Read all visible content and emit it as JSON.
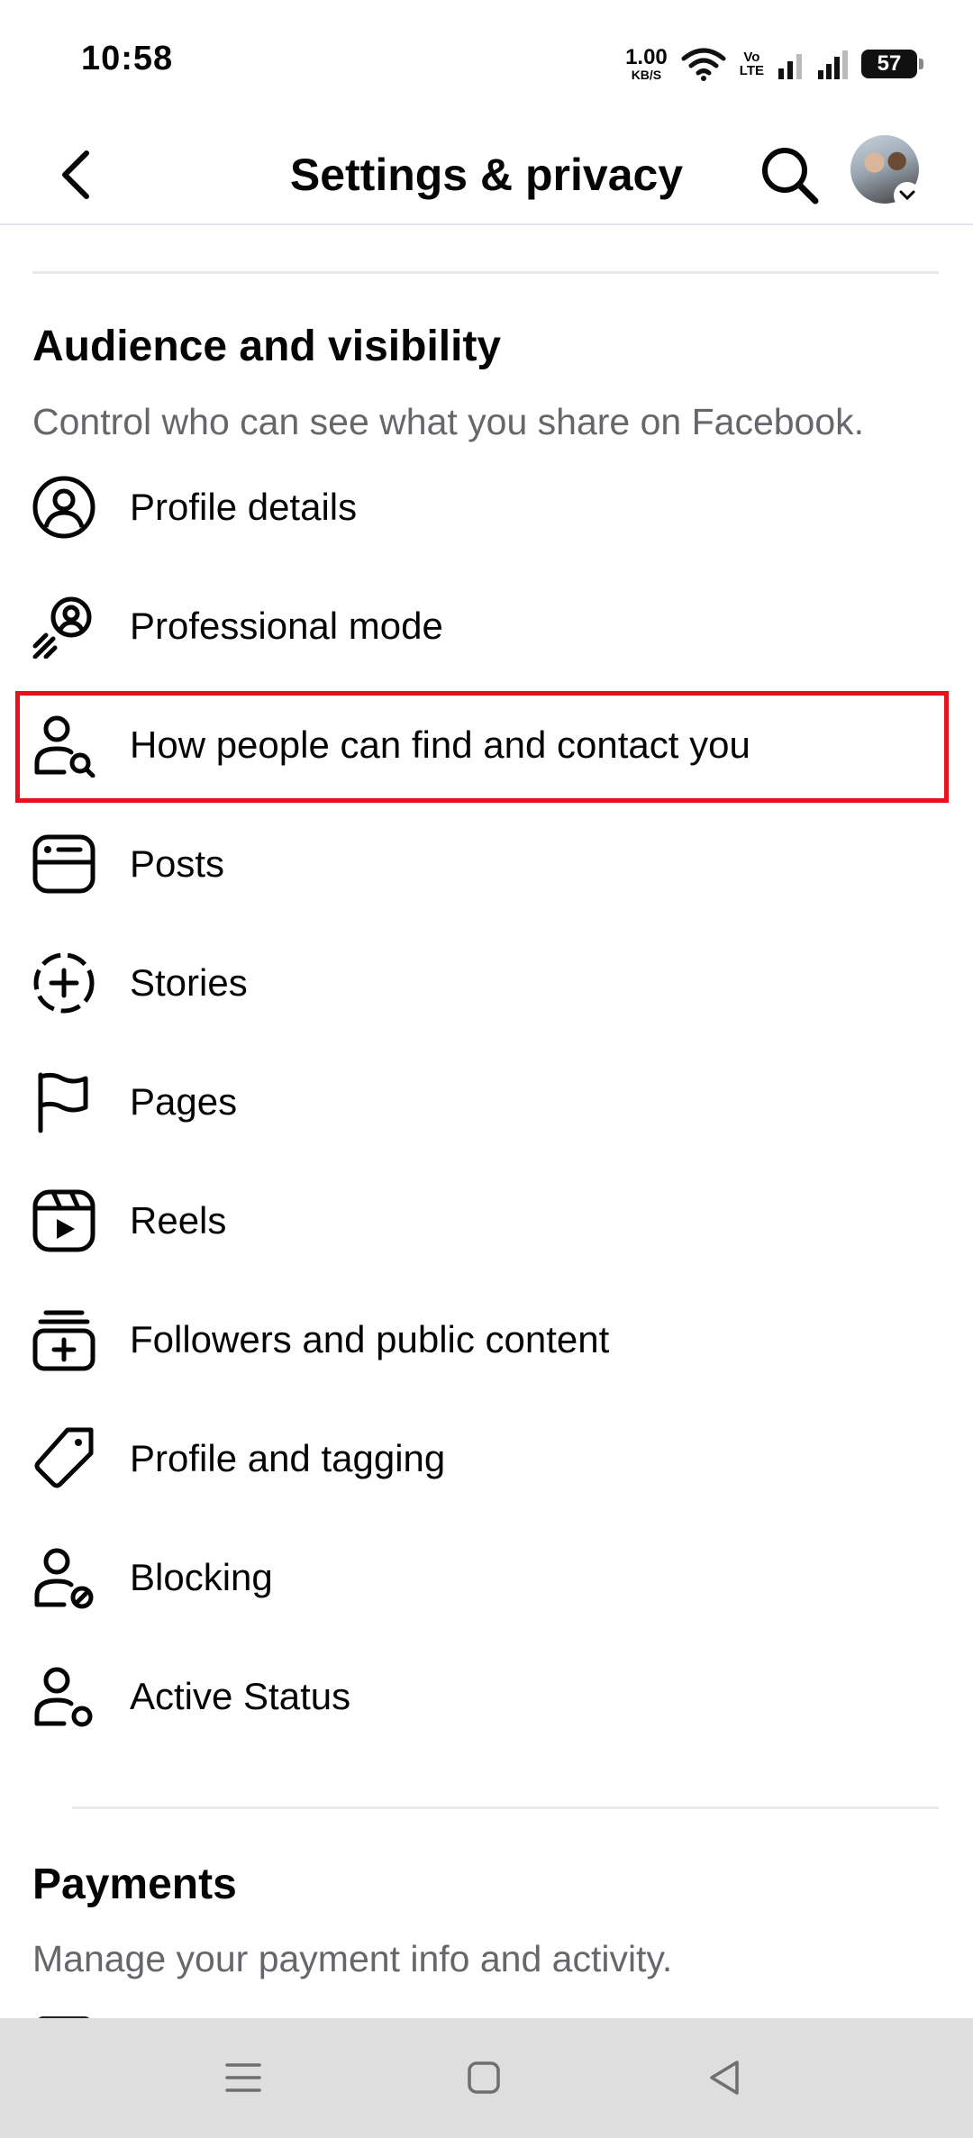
{
  "status_bar": {
    "time": "10:58",
    "net_speed_value": "1.00",
    "net_speed_unit": "KB/S",
    "volte_top": "Vo",
    "volte_bottom": "LTE",
    "battery": "57"
  },
  "header": {
    "title": "Settings & privacy",
    "back_icon": "chevron-left-icon",
    "search_icon": "search-icon"
  },
  "audience_section": {
    "title": "Audience and visibility",
    "description": "Control who can see what you share on Facebook.",
    "items": [
      {
        "label": "Profile details",
        "icon": "person-circle-icon"
      },
      {
        "label": "Professional mode",
        "icon": "professional-mode-icon"
      },
      {
        "label": "How people can find and contact you",
        "icon": "person-search-icon",
        "highlighted": true
      },
      {
        "label": "Posts",
        "icon": "posts-icon"
      },
      {
        "label": "Stories",
        "icon": "stories-plus-icon"
      },
      {
        "label": "Pages",
        "icon": "flag-icon"
      },
      {
        "label": "Reels",
        "icon": "reels-icon"
      },
      {
        "label": "Followers and public content",
        "icon": "followers-stack-icon"
      },
      {
        "label": "Profile and tagging",
        "icon": "tag-icon"
      },
      {
        "label": "Blocking",
        "icon": "person-block-icon"
      },
      {
        "label": "Active Status",
        "icon": "person-status-icon"
      }
    ]
  },
  "payments_section": {
    "title": "Payments",
    "description": "Manage your payment info and activity."
  },
  "nav_bar": {
    "menu_icon": "menu-lines-icon",
    "home_icon": "square-home-icon",
    "back_icon": "triangle-back-icon"
  },
  "colors": {
    "highlight": "#e3121b",
    "secondary_text": "#65676b",
    "nav_bg": "#dedede"
  }
}
